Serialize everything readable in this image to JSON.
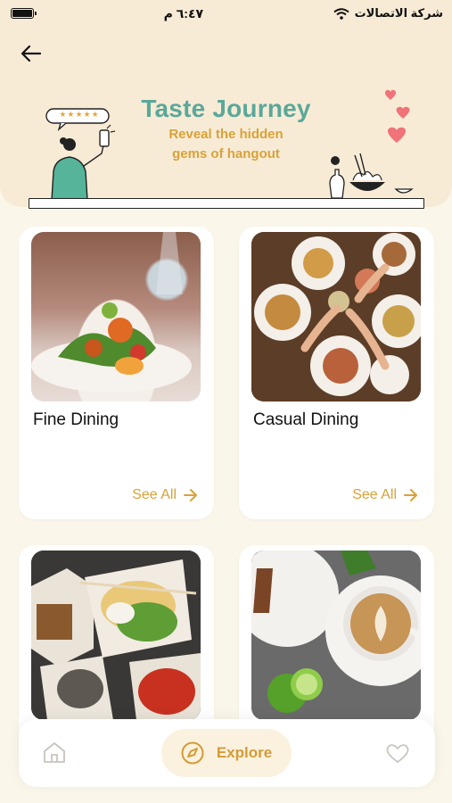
{
  "status_bar": {
    "time": "٦:٤٧ م",
    "carrier": "شركة الاتصالات"
  },
  "header": {
    "title": "Taste Journey",
    "subtitle_line1": "Reveal the hidden",
    "subtitle_line2": "gems of hangout",
    "rating_stars": "★★★★★"
  },
  "categories": [
    {
      "title": "Fine Dining",
      "see_all": "See All"
    },
    {
      "title": "Casual Dining",
      "see_all": "See All"
    },
    {
      "title": "",
      "see_all": ""
    },
    {
      "title": "",
      "see_all": ""
    }
  ],
  "bottom_nav": {
    "explore_label": "Explore",
    "active": "explore"
  },
  "colors": {
    "accent_green": "#5aa89a",
    "accent_gold": "#d6a23a",
    "header_bg": "#f8ebd6",
    "page_bg": "#fbf6ea"
  }
}
